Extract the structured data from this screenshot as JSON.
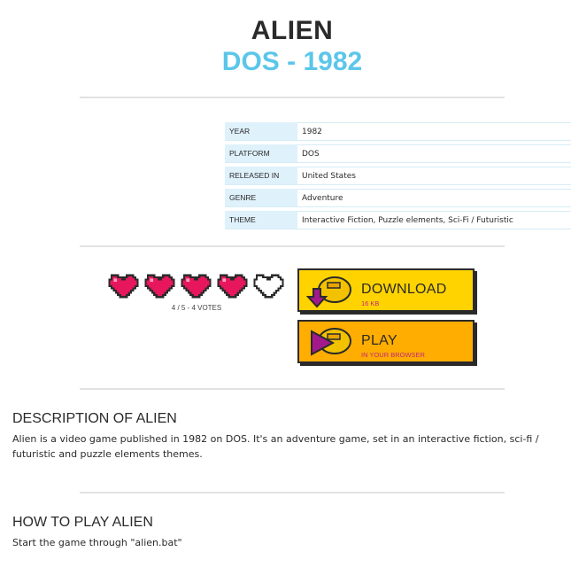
{
  "header": {
    "title": "ALIEN",
    "subtitle": "DOS - 1982"
  },
  "info": [
    {
      "key": "YEAR",
      "value": "1982"
    },
    {
      "key": "PLATFORM",
      "value": "DOS"
    },
    {
      "key": "RELEASED IN",
      "value": "United States"
    },
    {
      "key": "GENRE",
      "value": "Adventure"
    },
    {
      "key": "THEME",
      "value": "Interactive Fiction, Puzzle elements, Sci-Fi / Futuristic"
    }
  ],
  "rating": {
    "filled_hearts": 4,
    "total_hearts": 5,
    "votes_text": "4 / 5 - 4 VOTES"
  },
  "download": {
    "label": "DOWNLOAD",
    "sub": "16 KB"
  },
  "play": {
    "label": "PLAY",
    "sub": "IN YOUR BROWSER"
  },
  "description": {
    "heading": "DESCRIPTION OF ALIEN",
    "text": "Alien is a video game published in 1982 on DOS. It's an adventure game, set in an interactive fiction, sci-fi / futuristic and puzzle elements themes."
  },
  "howto": {
    "heading": "HOW TO PLAY ALIEN",
    "text": "Start the game through \"alien.bat\""
  },
  "colors": {
    "accent": "#5bc6ea",
    "heart_fill": "#e8175d",
    "download_bg": "#ffd300",
    "play_bg": "#ffad00",
    "arrow": "#a3198c"
  }
}
